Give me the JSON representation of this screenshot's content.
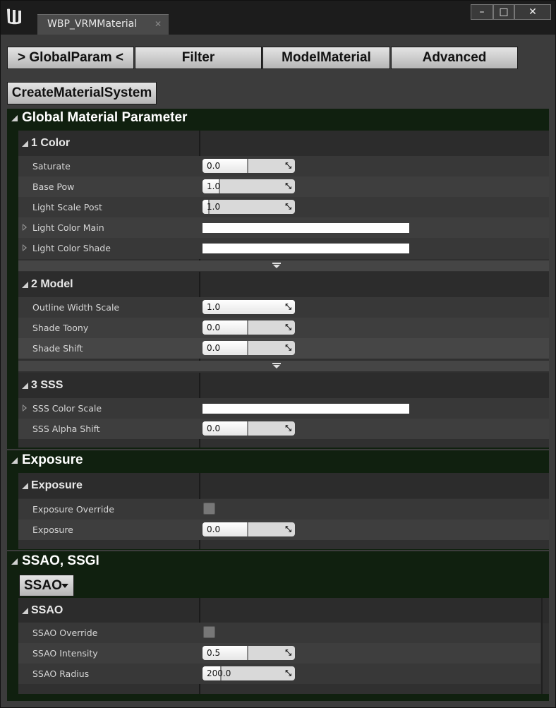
{
  "window": {
    "tab_title": "WBP_VRMMaterial",
    "tab_close": "✕",
    "minimize": "–",
    "maximize": "□",
    "close": "✕"
  },
  "nav": {
    "global_param": "> GlobalParam <",
    "filter": "Filter",
    "model_material": "ModelMaterial",
    "advanced": "Advanced"
  },
  "create_button": "CreateMaterialSystem",
  "global": {
    "title": "Global Material Parameter",
    "color": {
      "title": "1 Color",
      "rows": [
        {
          "label": "Saturate",
          "value": "0.0",
          "level": 0.5
        },
        {
          "label": "Base Pow",
          "value": "1.0",
          "level": 0.18
        },
        {
          "label": "Light Scale Post",
          "value": "1.0",
          "level": 0.0
        },
        {
          "label": "Light Color Main",
          "color": "#ffffff"
        },
        {
          "label": "Light Color Shade",
          "color": "#ffffff"
        }
      ]
    },
    "model": {
      "title": "2 Model",
      "rows": [
        {
          "label": "Outline Width Scale",
          "value": "1.0",
          "level": 1.0
        },
        {
          "label": "Shade Toony",
          "value": "0.0",
          "level": 0.5
        },
        {
          "label": "Shade Shift",
          "value": "0.0",
          "level": 0.5
        }
      ]
    },
    "sss": {
      "title": "3 SSS",
      "rows": [
        {
          "label": "SSS Color Scale",
          "color": "#ffffff"
        },
        {
          "label": "SSS Alpha Shift",
          "value": "0.0",
          "level": 0.5
        }
      ]
    }
  },
  "exposure": {
    "title": "Exposure",
    "category_title": "Exposure",
    "rows": [
      {
        "label": "Exposure Override",
        "checked": false
      },
      {
        "label": "Exposure",
        "value": "0.0",
        "level": 0.5
      }
    ]
  },
  "ssao": {
    "title": "SSAO, SSGI",
    "dropdown": "SSAO",
    "category_title": "SSAO",
    "rows": [
      {
        "label": "SSAO Override",
        "checked": false
      },
      {
        "label": "SSAO Intensity",
        "value": "0.5",
        "level": 0.5
      },
      {
        "label": "SSAO Radius",
        "value": "200.0",
        "level": 0.2
      }
    ]
  },
  "arrows_glyph": "⤡"
}
